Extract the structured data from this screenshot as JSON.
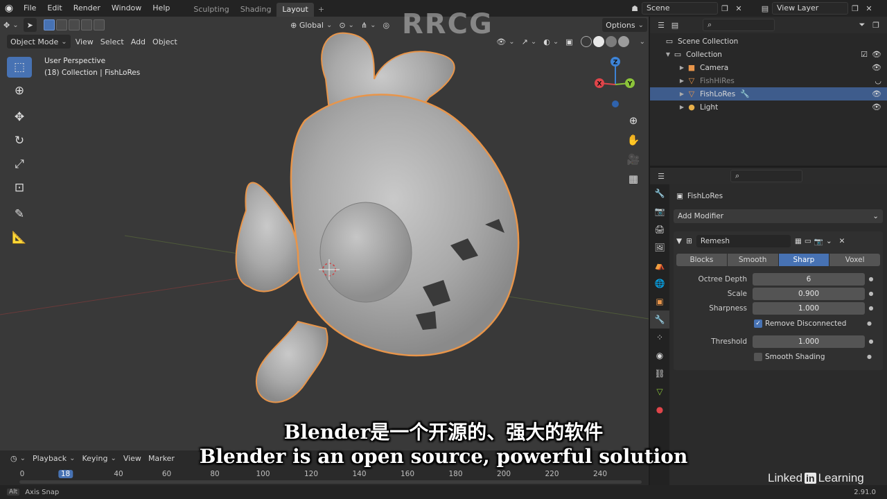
{
  "topbar": {
    "menu": [
      "File",
      "Edit",
      "Render",
      "Window",
      "Help"
    ],
    "workspaces": [
      "Sculpting",
      "Shading",
      "Layout"
    ],
    "active_workspace": "Layout",
    "scene": "Scene",
    "view_layer": "View Layer"
  },
  "viewport": {
    "mode": "Object Mode",
    "menus": [
      "View",
      "Select",
      "Add",
      "Object"
    ],
    "transform_orientation": "Global",
    "options": "Options",
    "perspective": "User Perspective",
    "collection_info": "(18) Collection | FishLoRes",
    "gizmo": {
      "z": "Z",
      "x": "X",
      "y": "Y"
    },
    "colors": {
      "background": "#393939",
      "selection_outline": "#e8954a",
      "x_axis": "#e0454a",
      "y_axis": "#8cc43a",
      "z_axis": "#3d83d6"
    },
    "tools": [
      "select-box-icon",
      "cursor-icon",
      "move-icon",
      "rotate-icon",
      "scale-icon",
      "transform-icon",
      "annotate-icon",
      "measure-icon"
    ],
    "nav_icons": [
      "zoom-icon",
      "hand-icon",
      "camera-icon",
      "grid-icon"
    ]
  },
  "outliner": {
    "root": "Scene Collection",
    "collection": "Collection",
    "items": [
      {
        "name": "Camera",
        "icon": "camera-icon",
        "selected": false,
        "dim": false
      },
      {
        "name": "FishHiRes",
        "icon": "mesh-icon",
        "selected": false,
        "dim": true
      },
      {
        "name": "FishLoRes",
        "icon": "mesh-icon",
        "selected": true,
        "dim": false
      },
      {
        "name": "Light",
        "icon": "light-icon",
        "selected": false,
        "dim": false
      }
    ]
  },
  "properties": {
    "object_name": "FishLoRes",
    "add_modifier": "Add Modifier",
    "modifier": {
      "name": "Remesh",
      "modes": [
        "Blocks",
        "Smooth",
        "Sharp",
        "Voxel"
      ],
      "active_mode": "Sharp",
      "octree_depth_label": "Octree Depth",
      "octree_depth": "6",
      "scale_label": "Scale",
      "scale": "0.900",
      "sharpness_label": "Sharpness",
      "sharpness": "1.000",
      "remove_disconnected_label": "Remove Disconnected",
      "remove_disconnected": true,
      "threshold_label": "Threshold",
      "threshold": "1.000",
      "smooth_shading_label": "Smooth Shading",
      "smooth_shading": false
    }
  },
  "timeline": {
    "menus": [
      "Playback",
      "Keying",
      "View",
      "Marker"
    ],
    "current_frame": "18",
    "ticks": [
      "0",
      "18",
      "40",
      "60",
      "80",
      "100",
      "120",
      "140",
      "160",
      "180",
      "200",
      "220",
      "240"
    ]
  },
  "statusbar": {
    "key": "Alt",
    "hint": "Axis Snap",
    "version": "2.91.0"
  },
  "overlay": {
    "subtitle_cn": "Blender是一个开源的、强大的软件",
    "subtitle_en": "Blender is an open source, powerful solution",
    "watermark": "RRCG",
    "brand_linked": "Linked",
    "brand_in": "in",
    "brand_learning": "Learning"
  }
}
